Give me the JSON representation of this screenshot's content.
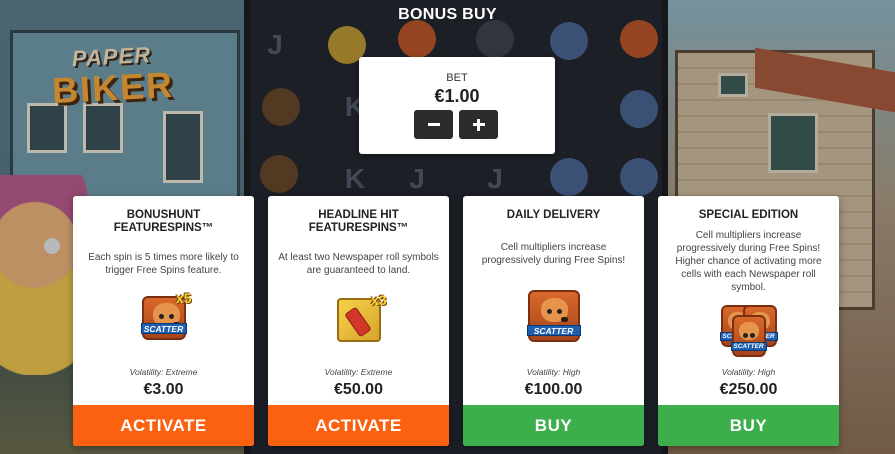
{
  "logo": {
    "line1": "PAPER",
    "line2": "BIKER"
  },
  "title": "BONUS BUY",
  "bet": {
    "label": "BET",
    "value": "€1.00",
    "decrease_icon": "minus-icon",
    "increase_icon": "plus-icon"
  },
  "cards": [
    {
      "title": "BONUSHUNT FEATURESPINS™",
      "description": "Each spin is 5 times more likely to trigger Free Spins feature.",
      "icon": "scatter-dog-x5-icon",
      "icon_multiplier": "x5",
      "icon_text": "SCATTER",
      "volatility": "Volatility: Extreme",
      "price": "€3.00",
      "action": "ACTIVATE",
      "action_color": "#fb6110"
    },
    {
      "title": "HEADLINE HIT FEATURESPINS™",
      "description": "At least two Newspaper roll symbols are guaranteed to land.",
      "icon": "newspaper-roll-x3-icon",
      "icon_multiplier": "x3",
      "volatility": "Volatility: Extreme",
      "price": "€50.00",
      "action": "ACTIVATE",
      "action_color": "#fb6110"
    },
    {
      "title": "DAILY DELIVERY",
      "description": "Cell multipliers increase progressively during Free Spins!",
      "icon": "scatter-dog-icon",
      "icon_text": "SCATTER",
      "volatility": "Volatility: High",
      "price": "€100.00",
      "action": "BUY",
      "action_color": "#3dae4c"
    },
    {
      "title": "SPECIAL EDITION",
      "description": "Cell multipliers increase progressively during Free Spins! Higher chance of activating more cells with each Newspaper roll symbol.",
      "icon": "scatter-dog-triple-icon",
      "icon_text": "SCATTER",
      "volatility": "Volatility: High",
      "price": "€250.00",
      "action": "BUY",
      "action_color": "#3dae4c"
    }
  ]
}
